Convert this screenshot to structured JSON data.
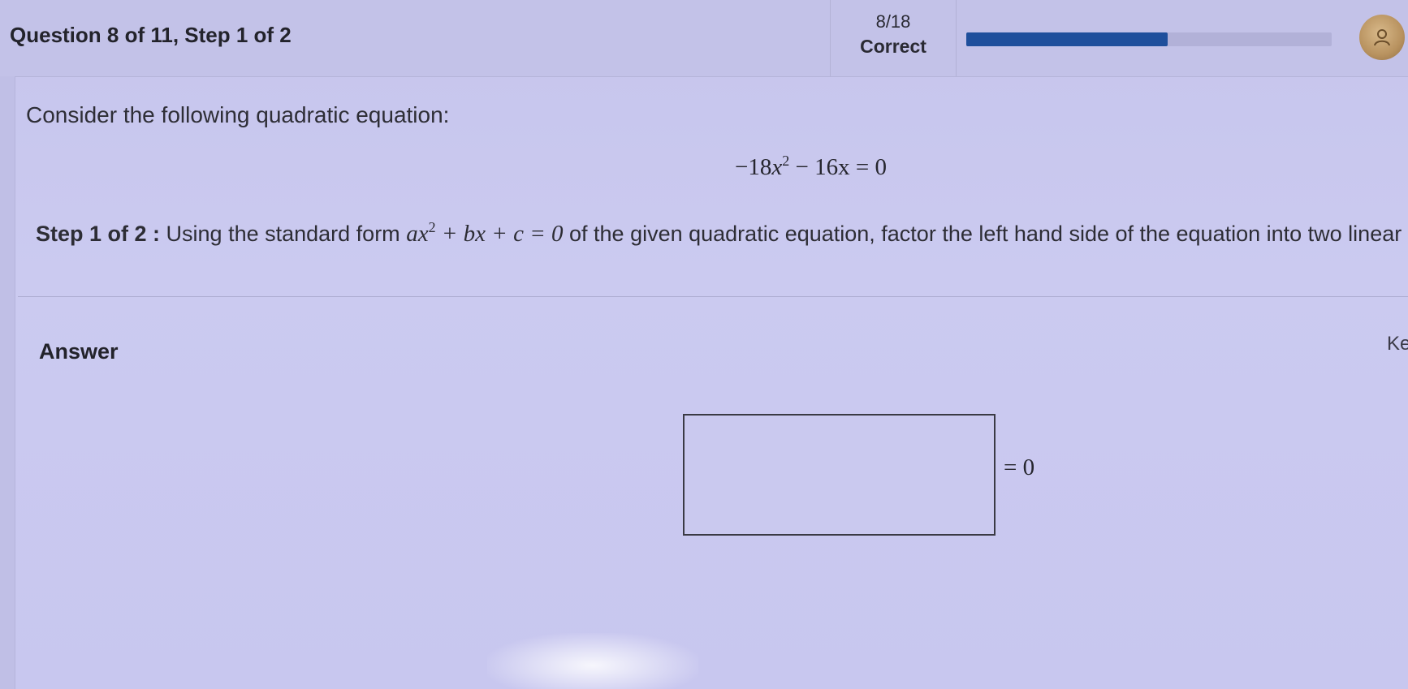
{
  "header": {
    "question_title": "Question 8 of 11, Step 1 of 2",
    "score_value": "8/18",
    "score_label": "Correct",
    "progress_fraction": 0.55,
    "avatar_icon": "avatar-icon"
  },
  "question": {
    "intro": "Consider the following quadratic equation:",
    "equation": {
      "coef_a": "−18",
      "var": "x",
      "exp": "2",
      "rest": " − 16x = 0"
    },
    "step_label": "Step 1 of 2 :",
    "step_text_before": " Using the standard form ",
    "standard_form": {
      "a": "ax",
      "exp": "2",
      "rest": " + bx + c = 0"
    },
    "step_text_after": " of the given quadratic equation, factor the left hand side of the equation into two linear factors."
  },
  "answer": {
    "label": "Answer",
    "keypad_label": "Ke",
    "input_value": "",
    "equals_suffix": "= 0"
  },
  "colors": {
    "progress_fill": "#1f4f9c",
    "progress_track": "#b2b1d8"
  }
}
